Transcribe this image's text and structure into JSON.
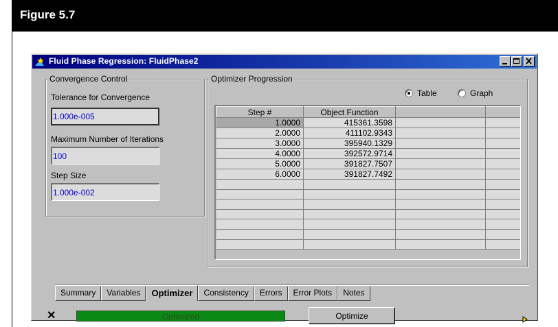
{
  "figure": {
    "title": "Figure 5.7"
  },
  "window": {
    "title": "Fluid Phase Regression:  FluidPhase2",
    "icon": "regression-icon"
  },
  "convergence": {
    "group_label": "Convergence Control",
    "tolerance_label": "Tolerance for Convergence",
    "tolerance_value": "1.000e-005",
    "max_iter_label": "Maximum Number of Iterations",
    "max_iter_value": "100",
    "step_size_label": "Step Size",
    "step_size_value": "1.000e-002"
  },
  "optimizer": {
    "group_label": "Optimizer Progression",
    "view_options": [
      "Table",
      "Graph"
    ],
    "selected_view": "Table",
    "columns": [
      "Step #",
      "Object Function",
      "",
      ""
    ],
    "rows": [
      [
        "1.0000",
        "415361.3598"
      ],
      [
        "2.0000",
        "411102.9343"
      ],
      [
        "3.0000",
        "395940.1329"
      ],
      [
        "4.0000",
        "392572.9714"
      ],
      [
        "5.0000",
        "391827.7507"
      ],
      [
        "6.0000",
        "391827.7492"
      ]
    ]
  },
  "tabs": [
    "Summary",
    "Variables",
    "Optimizer",
    "Consistency",
    "Errors",
    "Error Plots",
    "Notes"
  ],
  "active_tab": "Optimizer",
  "status": {
    "progress_text": "Optimized",
    "progress_color": "#0a8a14",
    "optimize_button": "Optimize"
  }
}
